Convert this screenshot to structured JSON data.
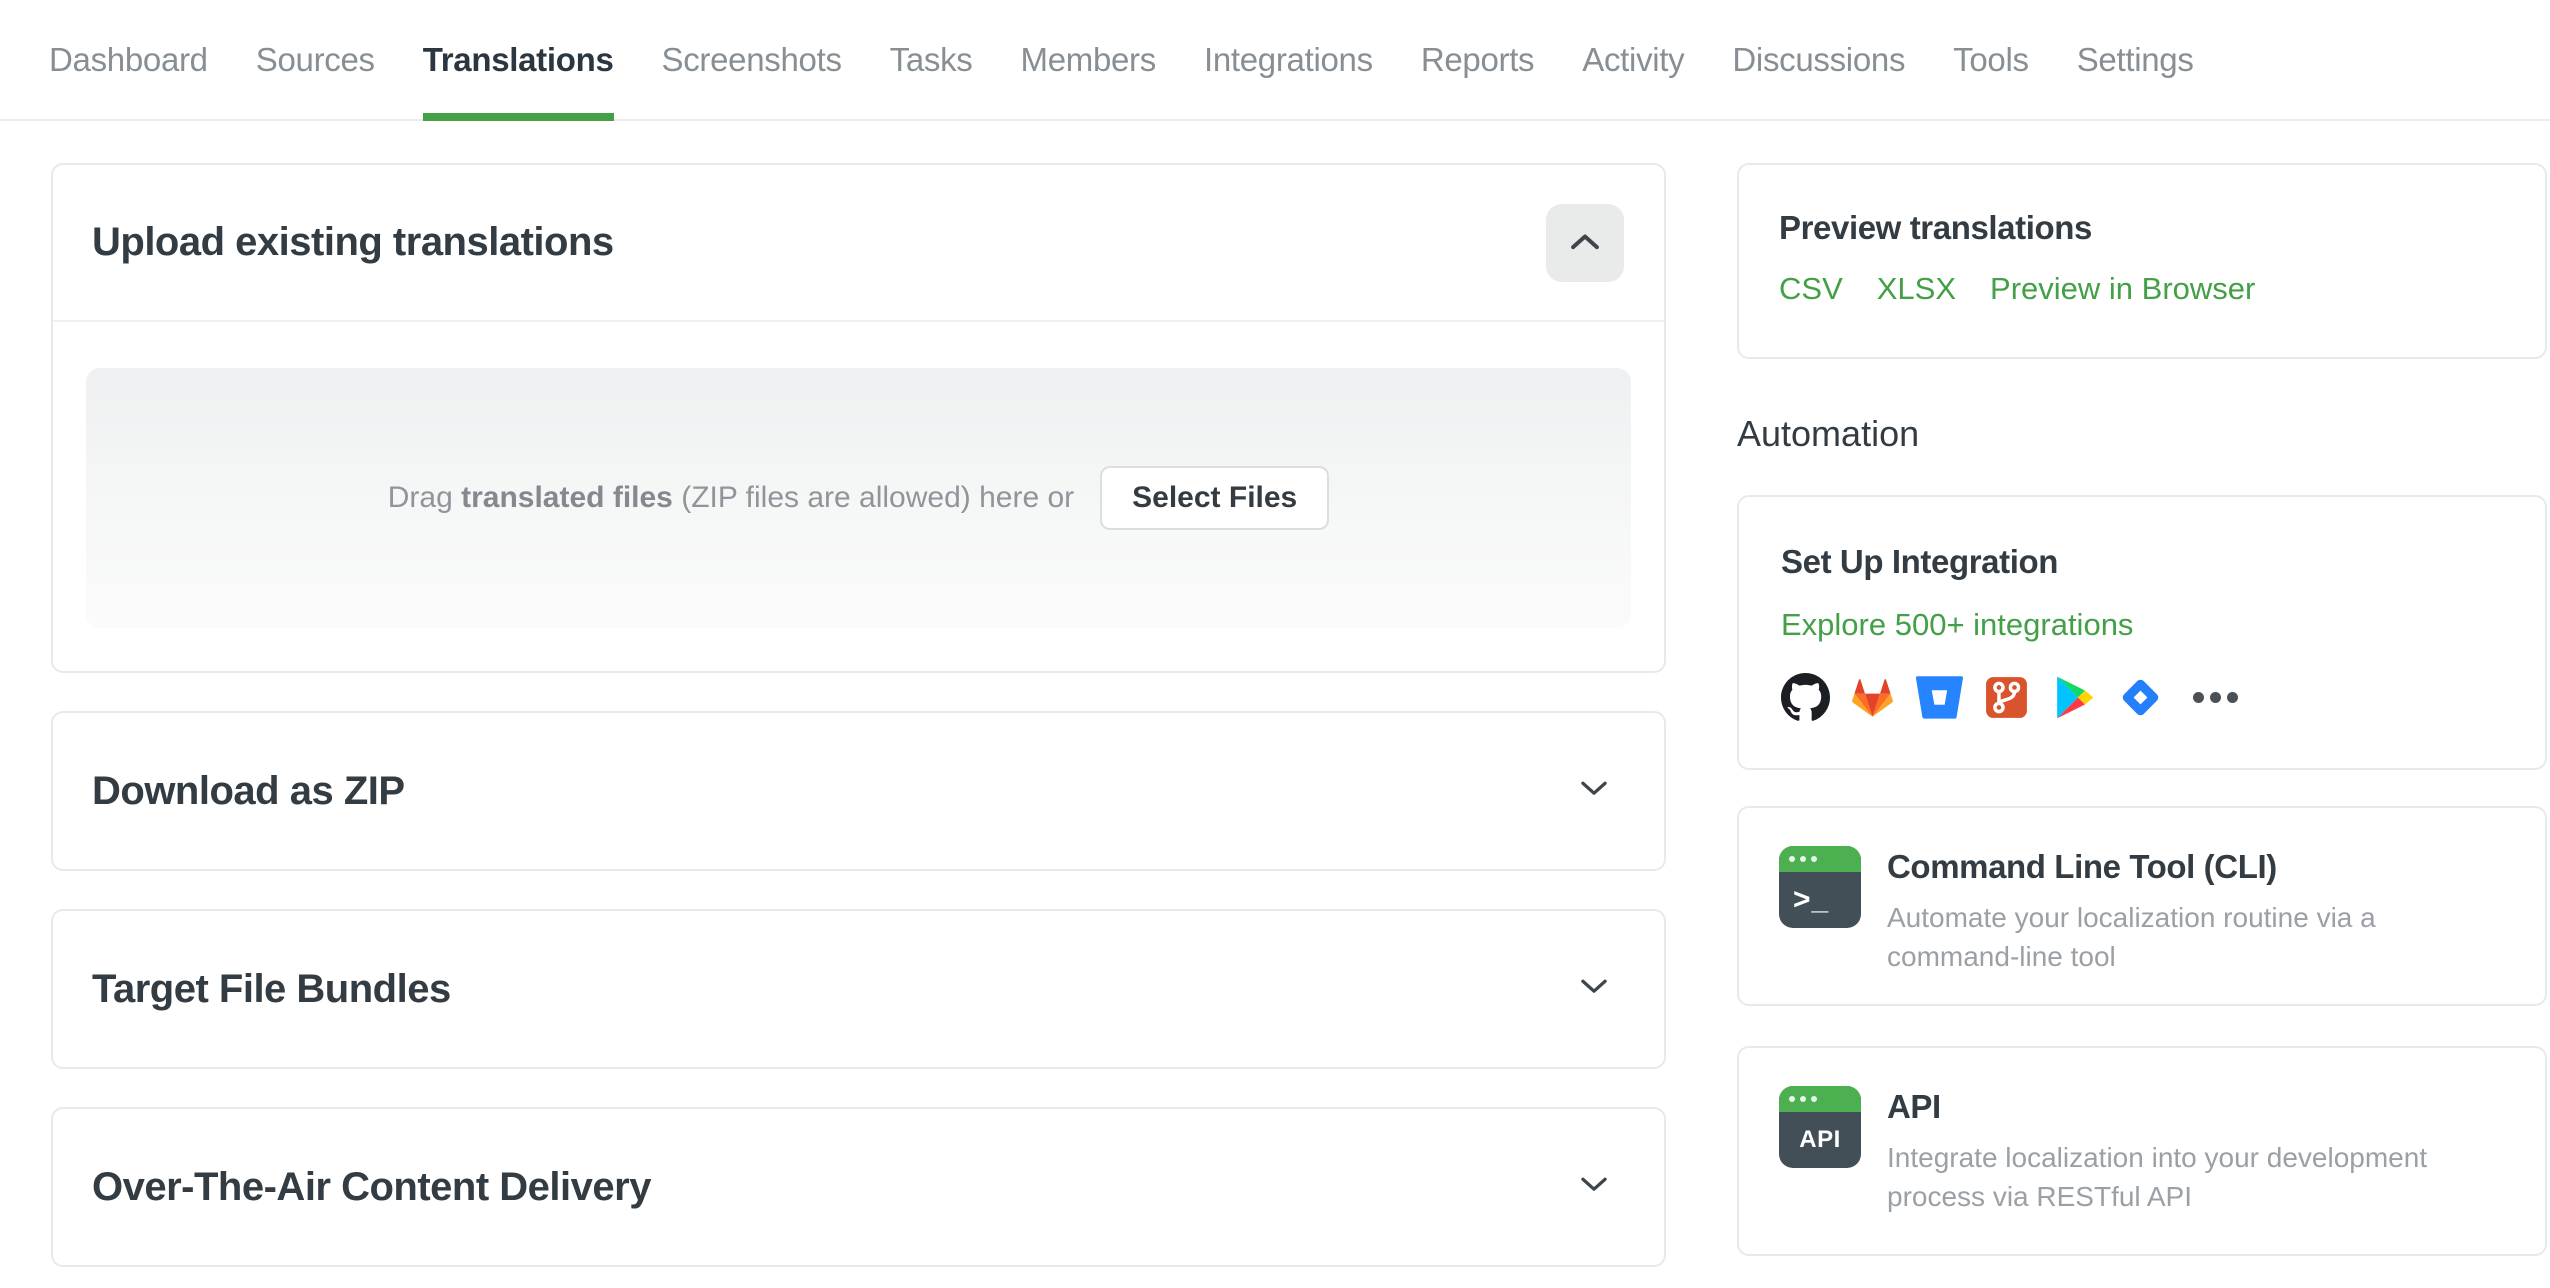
{
  "nav": {
    "tabs": [
      {
        "label": "Dashboard"
      },
      {
        "label": "Sources"
      },
      {
        "label": "Translations",
        "active": true
      },
      {
        "label": "Screenshots"
      },
      {
        "label": "Tasks"
      },
      {
        "label": "Members"
      },
      {
        "label": "Integrations"
      },
      {
        "label": "Reports"
      },
      {
        "label": "Activity"
      },
      {
        "label": "Discussions"
      },
      {
        "label": "Tools"
      },
      {
        "label": "Settings"
      }
    ]
  },
  "upload": {
    "title": "Upload existing translations",
    "collapse_icon": "chevron-up-icon",
    "dropzone": {
      "prefix": "Drag",
      "highlight": "translated files",
      "suffix": "(ZIP files are allowed) here or",
      "button": "Select Files"
    }
  },
  "sections": [
    {
      "title": "Download as ZIP",
      "icon": "chevron-down-icon"
    },
    {
      "title": "Target File Bundles",
      "icon": "chevron-down-icon"
    },
    {
      "title": "Over-The-Air Content Delivery",
      "icon": "chevron-down-icon"
    }
  ],
  "sidebar": {
    "preview": {
      "title": "Preview translations",
      "links": [
        {
          "label": "CSV"
        },
        {
          "label": "XLSX"
        },
        {
          "label": "Preview in Browser"
        }
      ]
    },
    "automation_heading": "Automation",
    "integration": {
      "title": "Set Up Integration",
      "link": "Explore 500+ integrations",
      "icons": [
        "github-icon",
        "gitlab-icon",
        "bitbucket-icon",
        "git-icon",
        "google-play-icon",
        "jira-icon",
        "more-icon"
      ]
    },
    "cli": {
      "icon_label": ">_",
      "title": "Command Line Tool (CLI)",
      "description": "Automate your localization routine via a command-line tool"
    },
    "api": {
      "icon_label": "API",
      "title": "API",
      "description": "Integrate localization into your development process via RESTful API"
    }
  },
  "colors": {
    "accent_green": "#43a047",
    "terminal_green": "#4caf50",
    "active_tab_text": "#2b3640",
    "inactive_tab_text": "#878f94",
    "heading_text": "#333c43",
    "muted_text": "#9aa0a5",
    "card_border": "#e7e9ea"
  }
}
